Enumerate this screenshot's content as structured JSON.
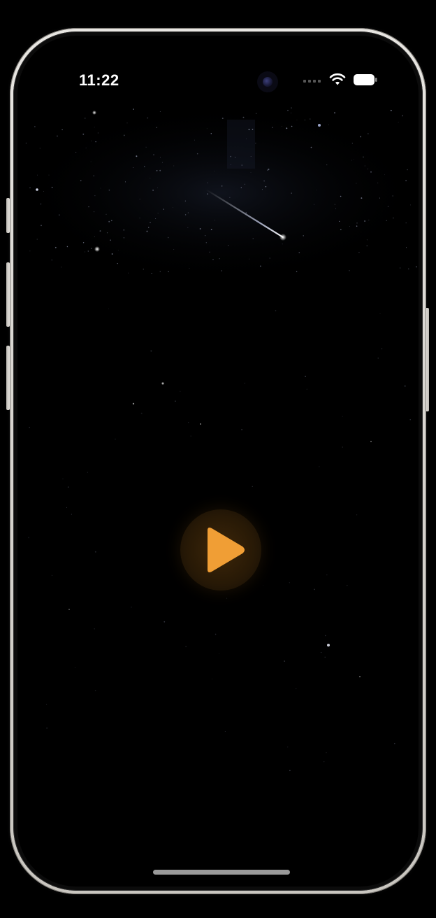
{
  "status_bar": {
    "time": "11:22",
    "signal_icon": "cellular-signal-icon",
    "wifi_icon": "wifi-icon",
    "battery_icon": "battery-icon"
  },
  "player": {
    "play_icon": "play-icon",
    "accent_color": "#F09E35"
  },
  "background": {
    "theme": "night-sky-starfield",
    "base_color": "#000000"
  }
}
